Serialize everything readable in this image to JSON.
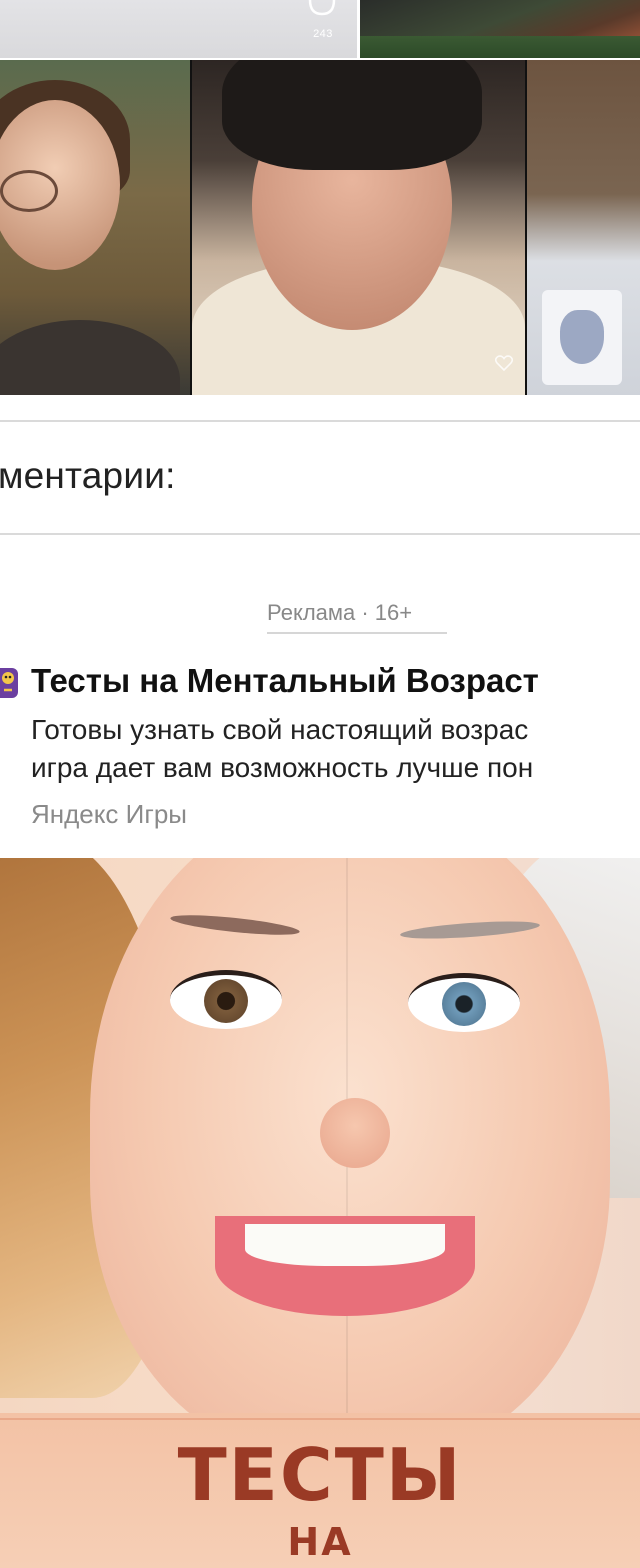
{
  "post": {
    "comment_count": "243",
    "icons": {
      "comment": "comment-bubble-icon",
      "like": "heart-icon"
    }
  },
  "comments": {
    "heading": "ментарии:"
  },
  "ad": {
    "label": "Реклама · 16+",
    "icon": "game-icon",
    "title": "Тесты на Ментальный Возраст",
    "description_line1": "Готовы узнать свой настоящий возрас",
    "description_line2": "игра дает вам возможность лучше пон",
    "source": "Яндекс Игры",
    "image_text_line1": "ТЕСТЫ",
    "image_text_line2": "НА"
  },
  "colors": {
    "ad_banner_text": "#9a3a25",
    "heading_text": "#222222",
    "muted_text": "#888888",
    "divider": "#dadada"
  }
}
